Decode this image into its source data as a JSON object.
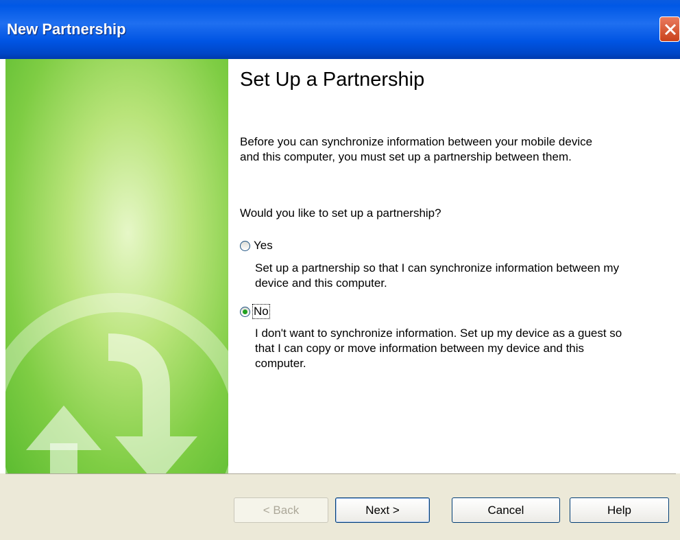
{
  "window": {
    "title": "New Partnership"
  },
  "heading": "Set Up a Partnership",
  "intro": "Before you can synchronize information between your mobile device and this computer, you must set up a partnership between them.",
  "question": "Would you like to set up a partnership?",
  "options": [
    {
      "label": "Yes",
      "description": "Set up a partnership so that I can synchronize information between my device and this computer.",
      "selected": false
    },
    {
      "label": "No",
      "description": "I don't want to synchronize information. Set up my device as a guest so that I can copy or move information between my device and this computer.",
      "selected": true
    }
  ],
  "buttons": {
    "back": "< Back",
    "next": "Next >",
    "cancel": "Cancel",
    "help": "Help"
  },
  "icons": {
    "close": "close-icon",
    "banner": "sync-arrows-icon"
  }
}
